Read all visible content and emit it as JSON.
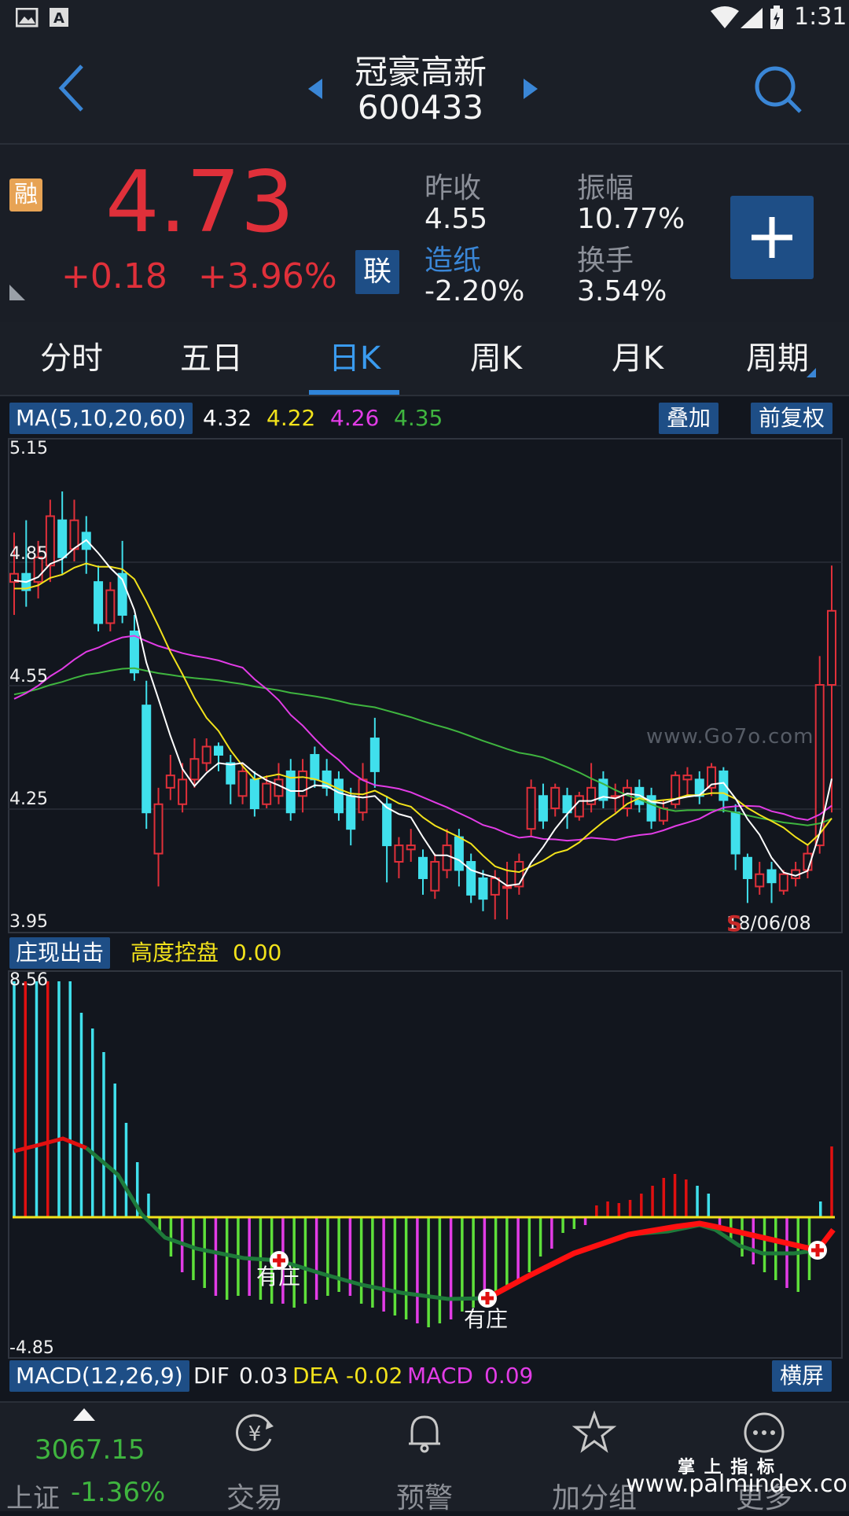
{
  "status_bar": {
    "time": "1:31"
  },
  "header": {
    "title": "冠豪高新",
    "code": "600433"
  },
  "quote": {
    "margin_badge": "融",
    "price": "4.73",
    "change": "+0.18",
    "change_pct": "+3.96%",
    "link_badge": "联",
    "prev_close_label": "昨收",
    "prev_close": "4.55",
    "amplitude_label": "振幅",
    "amplitude": "10.77%",
    "sector_label": "造纸",
    "sector_change": "-2.20%",
    "turnover_label": "换手",
    "turnover": "3.54%"
  },
  "tabs": [
    {
      "label": "分时"
    },
    {
      "label": "五日"
    },
    {
      "label": "日K"
    },
    {
      "label": "周K"
    },
    {
      "label": "月K"
    },
    {
      "label": "周期"
    }
  ],
  "kline_panel": {
    "ma_label": "MA(5,10,20,60)",
    "ma_values": [
      "4.32",
      "4.22",
      "4.26",
      "4.35"
    ],
    "ma_colors": [
      "#ffffff",
      "#f2e21b",
      "#e23ce6",
      "#3fb53f"
    ],
    "overlay_button": "叠加",
    "adjust_button": "前复权",
    "y_labels": [
      "5.15",
      "4.85",
      "4.55",
      "4.25",
      "3.95"
    ],
    "date": "18/06/08",
    "signal_marker": "S",
    "watermark": "www.Go7o.com"
  },
  "indicator_panel": {
    "name": "庄现出击",
    "metric_label": "高度控盘",
    "metric_value": "0.00",
    "y_max": "8.56",
    "y_min": "-4.85",
    "signal_label": "有庄"
  },
  "macd_panel": {
    "name": "MACD(12,26,9)",
    "dif_label": "DIF",
    "dif": "0.03",
    "dea_label": "DEA",
    "dea": "-0.02",
    "macd_label": "MACD",
    "macd": "0.09",
    "landscape_button": "横屏"
  },
  "bottom_nav": {
    "index_value": "3067.15",
    "index_name": "上证",
    "index_change": "-1.36%",
    "items": [
      {
        "label": "交易"
      },
      {
        "label": "预警"
      },
      {
        "label": "加分组"
      },
      {
        "label": "更多"
      }
    ]
  },
  "watermark_footer": {
    "line1": "掌 上 指 标",
    "line2": "www.palmindex.com"
  },
  "colors": {
    "up": "#e0303a",
    "down": "#40e0ec",
    "accent": "#2f84d8",
    "background": "#12161e"
  }
}
